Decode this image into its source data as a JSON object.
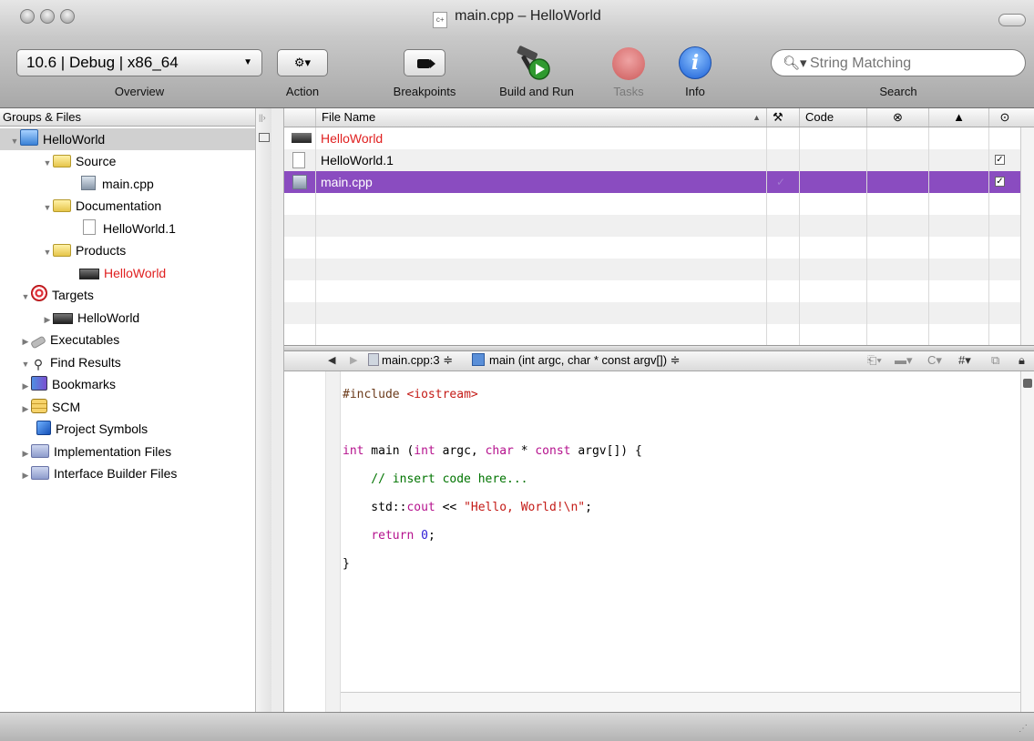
{
  "window": {
    "title": "main.cpp – HelloWorld"
  },
  "toolbar": {
    "config_value": "10.6 | Debug | x86_64",
    "items": [
      {
        "label": "Overview"
      },
      {
        "label": "Action"
      },
      {
        "label": "Breakpoints"
      },
      {
        "label": "Build and Run"
      },
      {
        "label": "Tasks"
      },
      {
        "label": "Info"
      },
      {
        "label": "Search"
      }
    ],
    "search_placeholder": "String Matching",
    "action_glyph": "⚙▾",
    "info_glyph": "i"
  },
  "sidebar": {
    "header": "Groups & Files",
    "items": [
      {
        "label": "HelloWorld",
        "icon": "project-icon"
      },
      {
        "label": "Source",
        "icon": "folder-icon"
      },
      {
        "label": "main.cpp",
        "icon": "cpp-file-icon"
      },
      {
        "label": "Documentation",
        "icon": "folder-icon"
      },
      {
        "label": "HelloWorld.1",
        "icon": "document-icon"
      },
      {
        "label": "Products",
        "icon": "folder-icon"
      },
      {
        "label": "HelloWorld",
        "icon": "application-icon",
        "color": "#e02020"
      },
      {
        "label": "Targets",
        "icon": "target-icon"
      },
      {
        "label": "HelloWorld",
        "icon": "target-application-icon"
      },
      {
        "label": "Executables",
        "icon": "executables-icon"
      },
      {
        "label": "Find Results",
        "icon": "magnifier-icon"
      },
      {
        "label": "Bookmarks",
        "icon": "bookmarks-icon"
      },
      {
        "label": "SCM",
        "icon": "scm-icon"
      },
      {
        "label": "Project Symbols",
        "icon": "symbols-cube-icon"
      },
      {
        "label": "Implementation Files",
        "icon": "smart-folder-icon"
      },
      {
        "label": "Interface Builder Files",
        "icon": "smart-folder-icon"
      }
    ]
  },
  "file_list": {
    "columns": {
      "name": "File Name",
      "code": "Code"
    },
    "rows": [
      {
        "name": "HelloWorld",
        "icon": "application-icon",
        "color": "#e02020",
        "checked": false,
        "check_visible": false
      },
      {
        "name": "HelloWorld.1",
        "icon": "document-icon",
        "checked": true,
        "check_visible": true
      },
      {
        "name": "main.cpp",
        "icon": "cpp-file-icon",
        "checked": true,
        "check_visible": true,
        "selected": true
      }
    ]
  },
  "editor": {
    "file_popup": "main.cpp:3 ≑",
    "function_popup": "main (int argc, char * const argv[]) ≑",
    "code_lines": [
      "#include <iostream>",
      "",
      "int main (int argc, char * const argv[]) {",
      "    // insert code here...",
      "    std::cout << \"Hello, World!\\n\";",
      "    return 0;",
      "}"
    ]
  },
  "colors": {
    "selection": "#8a4cc0",
    "keyword": "#b5118d",
    "comment": "#007400",
    "string": "#c41a16",
    "number": "#2d1cd6",
    "product_red": "#e02020"
  }
}
